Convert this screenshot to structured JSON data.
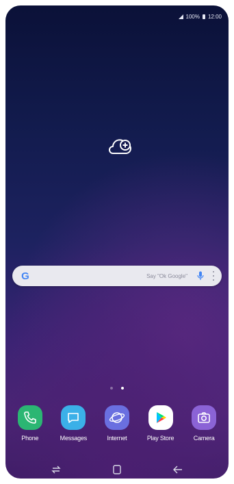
{
  "status_bar": {
    "battery": "100%",
    "time": "12:00"
  },
  "search": {
    "logo": "G",
    "placeholder": "Say \"Ok Google\"",
    "icons": [
      "google-logo",
      "microphone-icon",
      "more-vertical-icon"
    ]
  },
  "home": {
    "widget_icon": "cloud-add-icon",
    "pages": 2,
    "active_page": 2
  },
  "dock": {
    "apps": [
      {
        "label": "Phone",
        "icon": "phone-icon",
        "color": "#2bb673"
      },
      {
        "label": "Messages",
        "icon": "messages-icon",
        "color": "#3bb0e8"
      },
      {
        "label": "Internet",
        "icon": "internet-icon",
        "color": "#6a6fe0"
      },
      {
        "label": "Play Store",
        "icon": "play-store-icon",
        "color": "#ffffff"
      },
      {
        "label": "Camera",
        "icon": "camera-icon",
        "color": "#8b63d6"
      }
    ]
  },
  "nav": {
    "buttons": [
      "recents-icon",
      "home-icon",
      "back-icon"
    ]
  }
}
